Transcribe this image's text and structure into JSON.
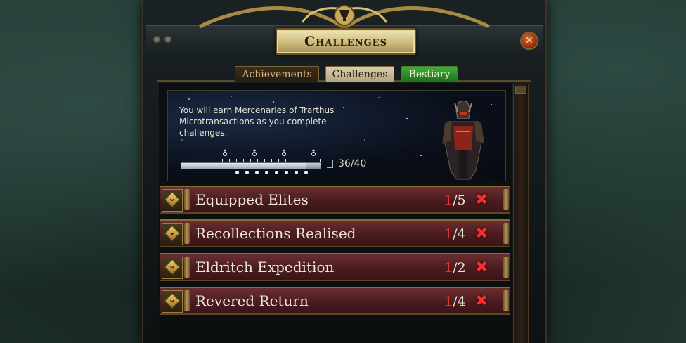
{
  "window": {
    "title": "Challenges",
    "close_icon": "close-icon"
  },
  "tabs": [
    {
      "label": "Achievements",
      "active": false
    },
    {
      "label": "Challenges",
      "active": true
    },
    {
      "label": "Bestiary",
      "active": false
    }
  ],
  "banner": {
    "text": "You will earn Mercenaries of Trarthus Microtransactions as you complete challenges.",
    "progress_completed": 36,
    "progress_total": 40,
    "progress_label": "36/40"
  },
  "challenges": [
    {
      "name": "Equipped Elites",
      "done": "1",
      "total": "/5",
      "status_icon": "red-x-icon"
    },
    {
      "name": "Recollections Realised",
      "done": "1",
      "total": "/4",
      "status_icon": "red-x-icon"
    },
    {
      "name": "Eldritch Expedition",
      "done": "1",
      "total": "/2",
      "status_icon": "red-x-icon"
    },
    {
      "name": "Revered Return",
      "done": "1",
      "total": "/4",
      "status_icon": "red-x-icon"
    }
  ],
  "colors": {
    "accent_gold": "#cdbb7c",
    "incomplete_red": "#e23a2d",
    "bestiary_green": "#3fae39",
    "row_red": "#6b2e30"
  }
}
